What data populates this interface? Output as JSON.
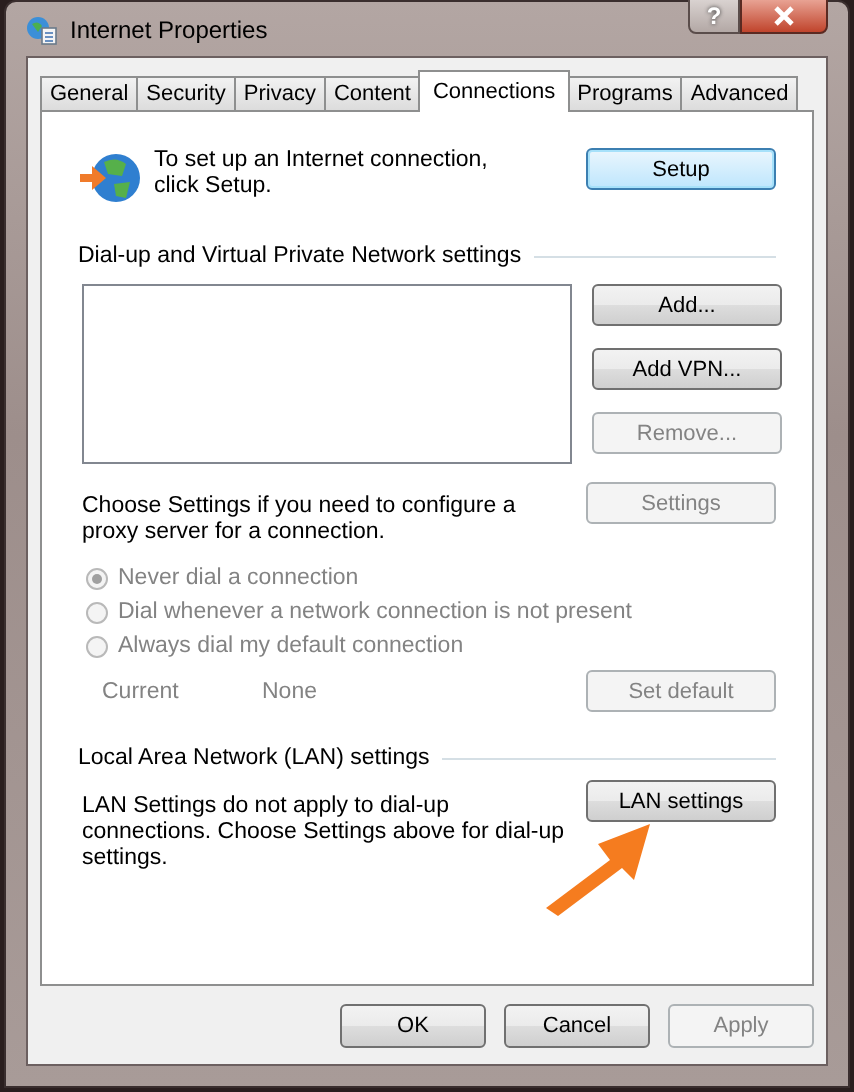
{
  "window": {
    "title": "Internet Properties",
    "help_button": "?"
  },
  "tabs": [
    {
      "label": "General",
      "selected": false
    },
    {
      "label": "Security",
      "selected": false
    },
    {
      "label": "Privacy",
      "selected": false
    },
    {
      "label": "Content",
      "selected": false
    },
    {
      "label": "Connections",
      "selected": true
    },
    {
      "label": "Programs",
      "selected": false
    },
    {
      "label": "Advanced",
      "selected": false
    }
  ],
  "setup": {
    "text": "To set up an Internet connection, click Setup.",
    "button": "Setup"
  },
  "vpn": {
    "heading": "Dial-up and Virtual Private Network settings",
    "buttons": [
      {
        "label": "Add...",
        "disabled": false
      },
      {
        "label": "Add VPN...",
        "disabled": false
      },
      {
        "label": "Remove...",
        "disabled": true
      }
    ],
    "proxy_text": "Choose Settings if you need to configure a proxy server for a connection.",
    "settings_button": {
      "label": "Settings",
      "disabled": true
    },
    "dial_options": [
      {
        "label": "Never dial a connection",
        "selected": true,
        "disabled": true
      },
      {
        "label": "Dial whenever a network connection is not present",
        "selected": false,
        "disabled": true
      },
      {
        "label": "Always dial my default connection",
        "selected": false,
        "disabled": true
      }
    ],
    "current_label": "Current",
    "current_value": "None",
    "set_default_button": {
      "label": "Set default",
      "disabled": true
    }
  },
  "lan": {
    "heading": "Local Area Network (LAN) settings",
    "text": "LAN Settings do not apply to dial-up connections. Choose Settings above for dial-up settings.",
    "button": "LAN settings"
  },
  "footer_buttons": [
    {
      "label": "OK",
      "disabled": false
    },
    {
      "label": "Cancel",
      "disabled": false
    },
    {
      "label": "Apply",
      "disabled": true
    }
  ]
}
